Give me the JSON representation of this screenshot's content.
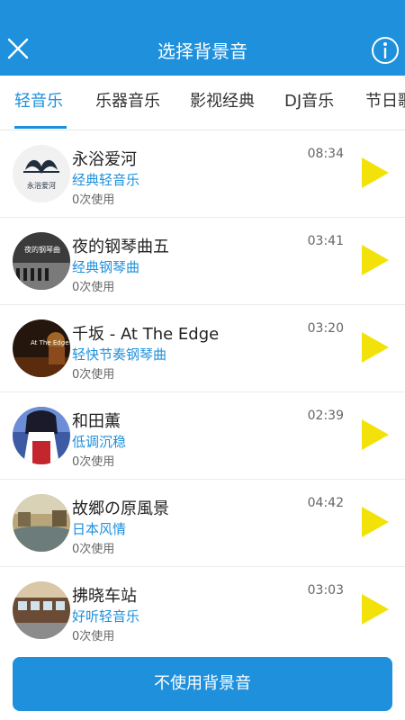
{
  "header": {
    "title": "选择背景音",
    "close_icon": "close-icon",
    "info_icon": "info-icon"
  },
  "tabs": [
    {
      "label": "轻音乐",
      "active": true
    },
    {
      "label": "乐器音乐",
      "active": false
    },
    {
      "label": "影视经典",
      "active": false
    },
    {
      "label": "DJ音乐",
      "active": false
    },
    {
      "label": "节日歌",
      "active": false
    }
  ],
  "songs": [
    {
      "title": "永浴爱河",
      "category": "经典轻音乐",
      "uses": "0次使用",
      "duration": "08:34",
      "cover_text": "永浴爱河"
    },
    {
      "title": "夜的钢琴曲五",
      "category": "经典钢琴曲",
      "uses": "0次使用",
      "duration": "03:41",
      "cover_text": "夜的钢琴曲"
    },
    {
      "title": "千坂 - At The Edge",
      "category": "轻快节奏钢琴曲",
      "uses": "0次使用",
      "duration": "03:20",
      "cover_text": "At The Edge"
    },
    {
      "title": "和田薫",
      "category": "低调沉稳",
      "uses": "0次使用",
      "duration": "02:39",
      "cover_text": ""
    },
    {
      "title": "故郷の原風景",
      "category": "日本风情",
      "uses": "0次使用",
      "duration": "04:42",
      "cover_text": ""
    },
    {
      "title": "拂晓车站",
      "category": "好听轻音乐",
      "uses": "0次使用",
      "duration": "03:03",
      "cover_text": ""
    }
  ],
  "footer": {
    "button_label": "不使用背景音"
  },
  "colors": {
    "accent": "#1e90dc",
    "play": "#f2e20a"
  }
}
